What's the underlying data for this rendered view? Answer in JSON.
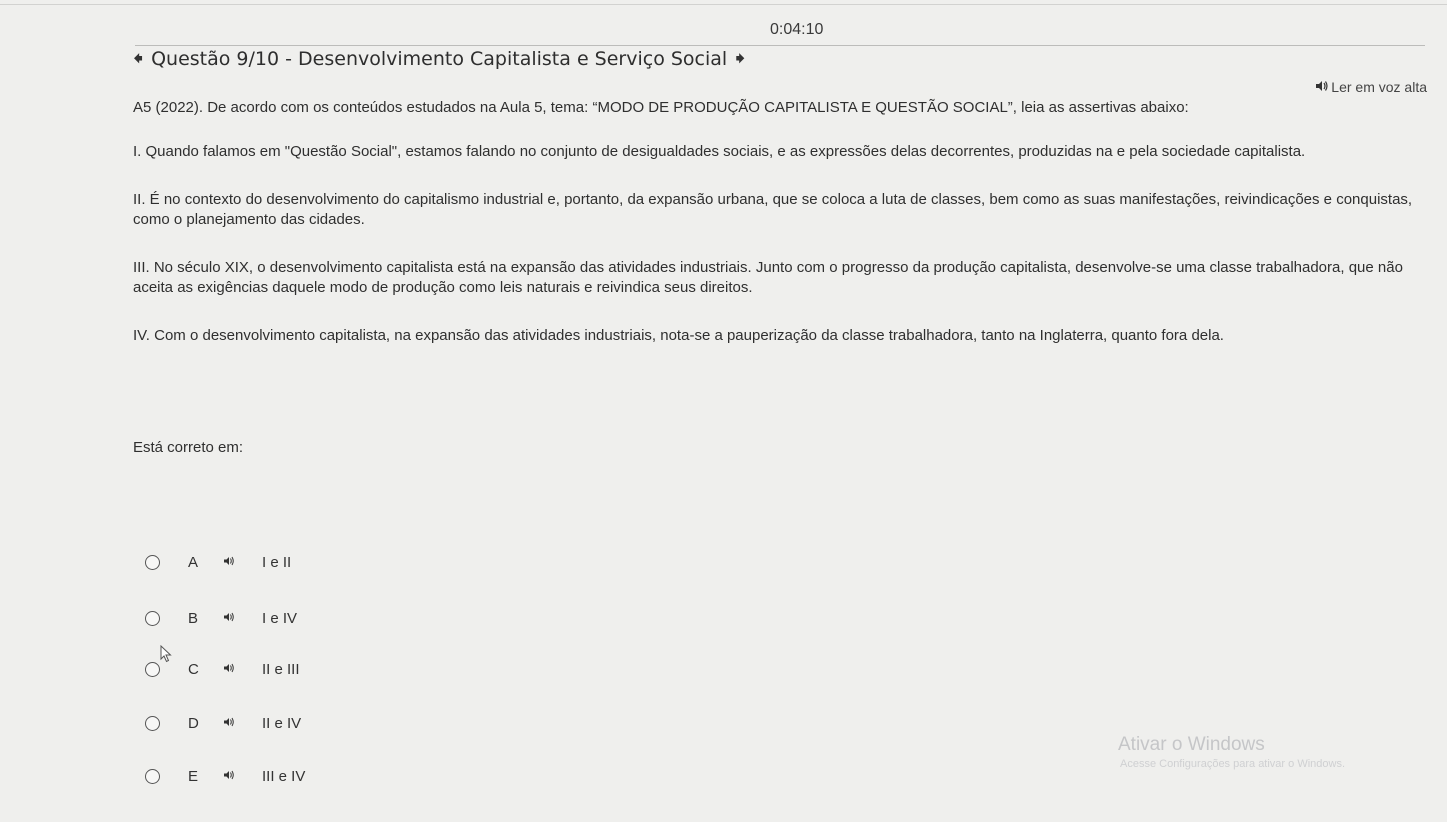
{
  "timer": "0:04:10",
  "header": {
    "title": "Questão 9/10 - Desenvolvimento Capitalista e Serviço Social",
    "prev_icon": "arrow-left-icon",
    "next_icon": "arrow-right-icon"
  },
  "read_aloud": {
    "icon": "speaker-icon",
    "label": "Ler em voz alta"
  },
  "question": {
    "intro": "A5 (2022). De acordo com os conteúdos estudados na Aula 5, tema: “MODO DE PRODUÇÃO CAPITALISTA E QUESTÃO SOCIAL”, leia as assertivas abaixo:",
    "statements": [
      "I. Quando falamos em \"Questão Social\", estamos falando no conjunto de desigualdades sociais, e as expressões delas decorrentes, produzidas na e pela sociedade capitalista.",
      "II. É no contexto do desenvolvimento do capitalismo industrial e, portanto, da expansão urbana, que se coloca a luta de classes, bem como as suas manifestações, reivindicações e conquistas, como o planejamento das cidades.",
      "III. No século XIX, o desenvolvimento capitalista está na expansão das atividades industriais. Junto com o progresso da produção capitalista, desenvolve-se uma classe trabalhadora, que não aceita as exigências daquele modo de produção como leis naturais e reivindica seus direitos.",
      "IV. Com o desenvolvimento capitalista, na expansão das atividades industriais, nota-se a pauperização da classe trabalhadora, tanto na Inglaterra, quanto fora dela."
    ],
    "prompt": "Está correto em:"
  },
  "options": [
    {
      "letter": "A",
      "text": "I e II"
    },
    {
      "letter": "B",
      "text": "I e IV"
    },
    {
      "letter": "C",
      "text": "II e III"
    },
    {
      "letter": "D",
      "text": "II e IV"
    },
    {
      "letter": "E",
      "text": "III e IV"
    }
  ],
  "watermark": {
    "title": "Ativar o Windows",
    "subtitle": "Acesse Configurações para ativar o Windows."
  }
}
